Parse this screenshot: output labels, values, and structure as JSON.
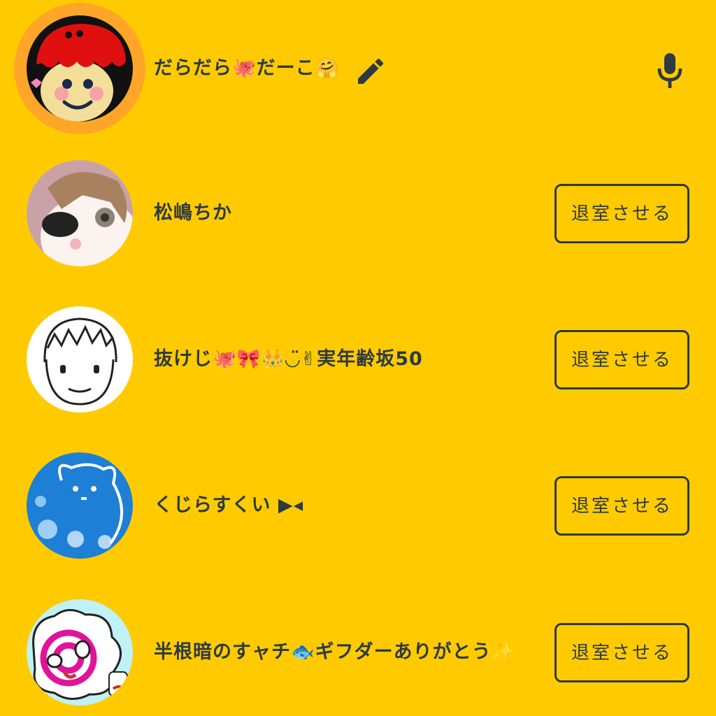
{
  "host": {
    "name": "だらだら🐙だーこ🤗",
    "edit_icon": "pencil-icon",
    "mic_icon": "microphone-icon"
  },
  "members": [
    {
      "name": "松嶋ちか",
      "kick_label": "退室させる"
    },
    {
      "name": "抜けじ🐙🎀👑◡̈✌実年齢坂50",
      "kick_label": "退室させる"
    },
    {
      "name": "くじらすくい ▶◂",
      "kick_label": "退室させる"
    },
    {
      "name": "半根暗のすャチ🐟ギフダーありがとう✨",
      "kick_label": "退室させる"
    }
  ],
  "colors": {
    "background": "#FFCB00",
    "host_ring": "#FFA629",
    "text": "#2E3A40"
  }
}
